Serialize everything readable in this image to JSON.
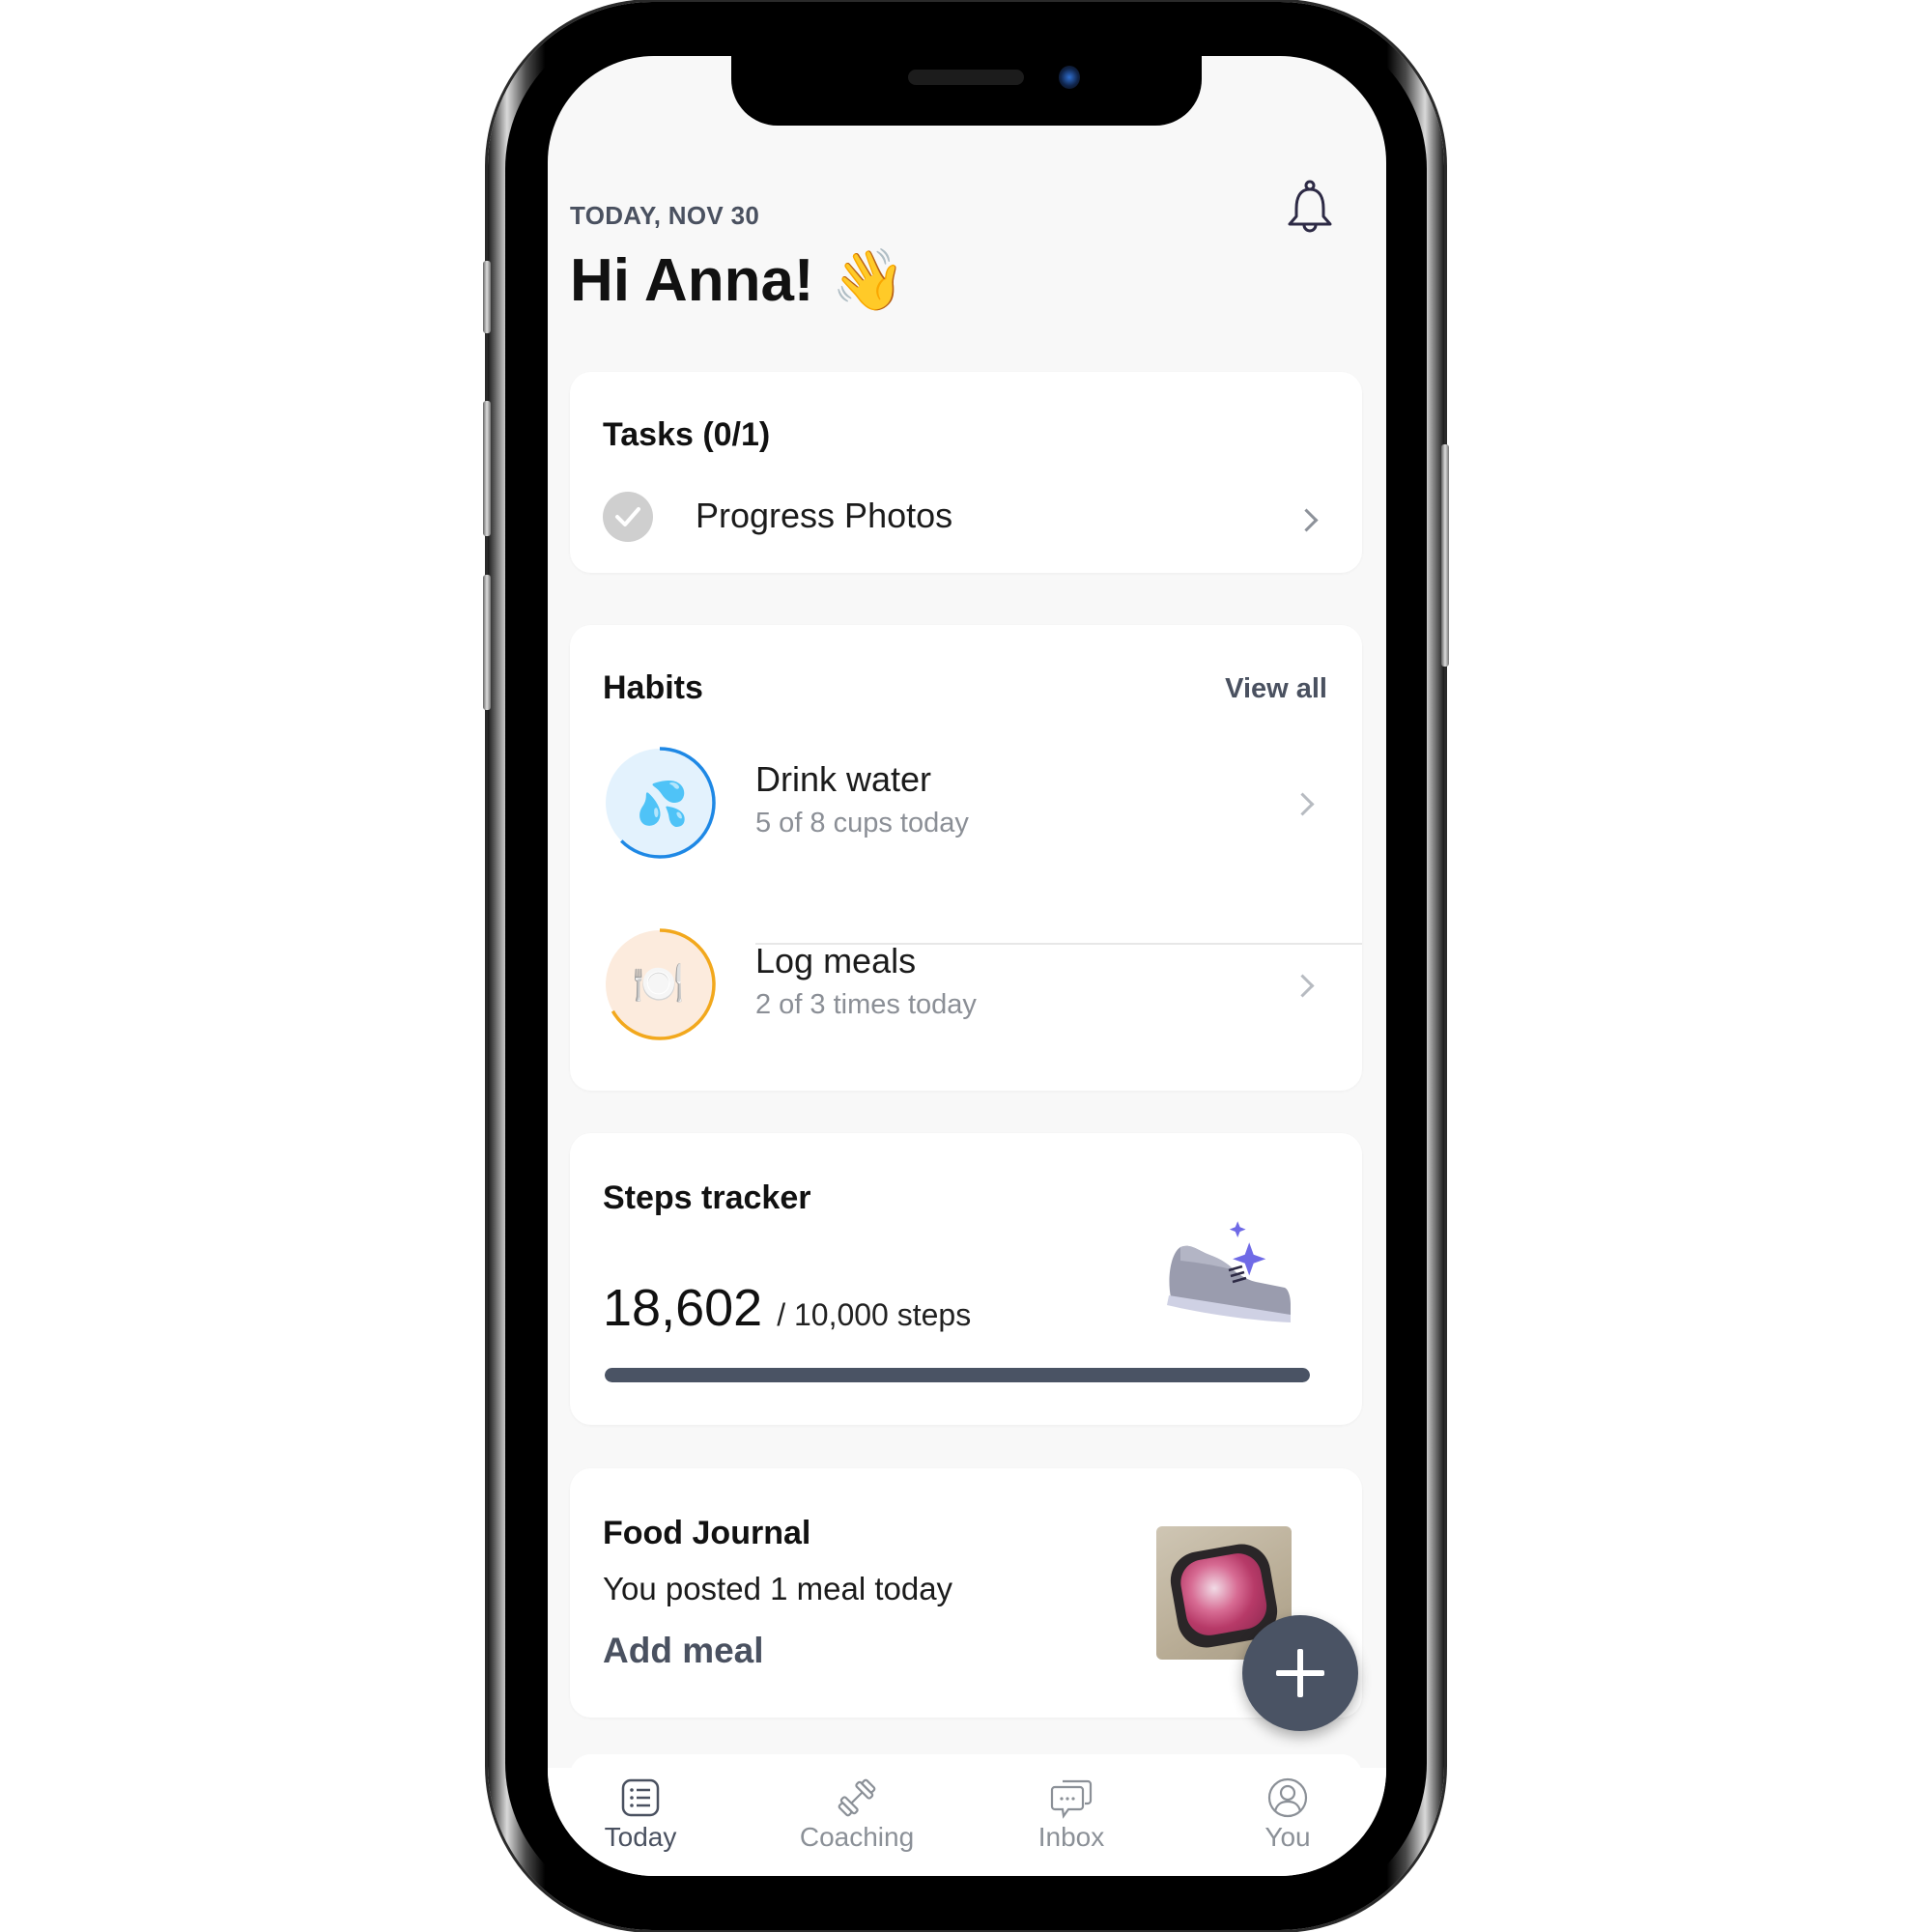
{
  "header": {
    "date": "TODAY, NOV 30",
    "greeting": "Hi Anna!",
    "greeting_emoji": "👋",
    "notification_icon": "bell-icon"
  },
  "tasks": {
    "title": "Tasks (0/1)",
    "items": [
      {
        "label": "Progress Photos",
        "completed": false,
        "icon": "check-circle-icon"
      }
    ]
  },
  "habits": {
    "title": "Habits",
    "view_all": "View all",
    "items": [
      {
        "name": "Drink water",
        "progress_text": "5 of 8 cups today",
        "done": 5,
        "goal": 8,
        "icon": "water-drops-icon",
        "emoji": "💦",
        "color": "#1e88e5",
        "bg": "#e3f2fd"
      },
      {
        "name": "Log meals",
        "progress_text": "2 of 3 times today",
        "done": 2,
        "goal": 3,
        "icon": "plate-cutlery-icon",
        "emoji": "🍽️",
        "color": "#f2a81d",
        "bg": "#fcebdd"
      }
    ]
  },
  "steps": {
    "title": "Steps tracker",
    "count": "18,602",
    "goal_text": "/ 10,000 steps",
    "progress": 1.0,
    "icon": "sneaker-icon"
  },
  "food_journal": {
    "title": "Food Journal",
    "subtitle": "You posted 1 meal today",
    "action": "Add meal",
    "photo": "meal-photo"
  },
  "fab": {
    "icon": "plus-icon"
  },
  "tabbar": {
    "tabs": [
      {
        "label": "Today",
        "icon": "list-icon",
        "active": true
      },
      {
        "label": "Coaching",
        "icon": "dumbbell-icon",
        "active": false
      },
      {
        "label": "Inbox",
        "icon": "chat-bubbles-icon",
        "active": false
      },
      {
        "label": "You",
        "icon": "user-icon",
        "active": false
      }
    ]
  },
  "colors": {
    "accent": "#4a5364",
    "background": "#f8f8f8",
    "card": "#ffffff"
  }
}
